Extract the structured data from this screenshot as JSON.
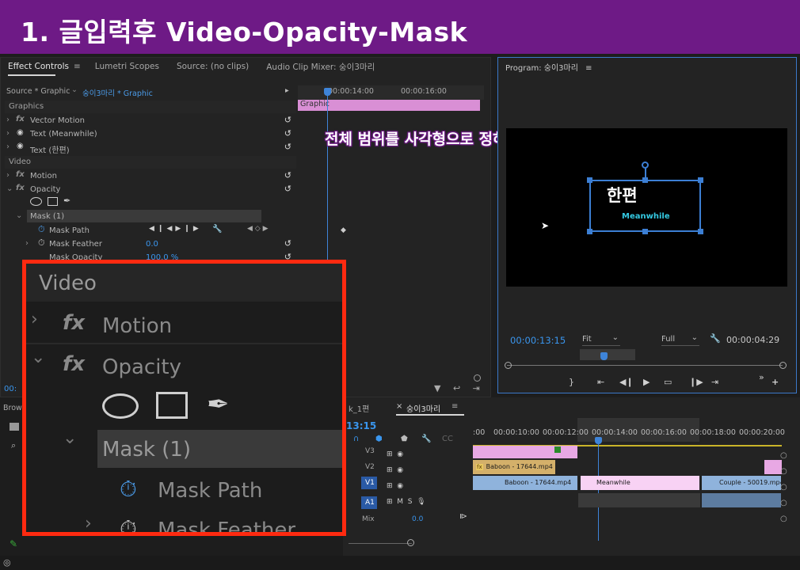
{
  "page_title": "1. 글입력후 Video-Opacity-Mask",
  "caption": "전체 범위를 사각형으로 정하고 KF생성",
  "top_tabs": {
    "effect_controls": "Effect Controls",
    "lumetri": "Lumetri Scopes",
    "source": "Source: (no clips)",
    "audio_mixer": "Audio Clip Mixer: 숭이3마리"
  },
  "source_selector": {
    "source": "Source * Graphic",
    "sequence": "숭이3마리 * Graphic"
  },
  "effect_controls": {
    "graphics_header": "Graphics",
    "vector_motion": "Vector Motion",
    "text_meanwhile": "Text (Meanwhile)",
    "text_hanpyeon": "Text (한편)",
    "video_header": "Video",
    "motion": "Motion",
    "opacity": "Opacity",
    "mask": "Mask (1)",
    "mask_path": "Mask Path",
    "mask_feather": "Mask Feather",
    "mask_feather_value": "0.0",
    "mask_opacity": "Mask Opacity",
    "mask_opacity_value": "100.0 %",
    "fx_symbol": "fx"
  },
  "ec_timeline": {
    "tc1": "00:00:14:00",
    "tc2": "00:00:16:00",
    "graphic_clip": "Graphic",
    "current_tc": "00:"
  },
  "program": {
    "title": "Program: 숭이3마리",
    "title_text": "한편",
    "subtitle_text": "Meanwhile",
    "timecode": "00:00:13:15",
    "fit": "Fit",
    "full": "Full",
    "duration": "00:00:04:29"
  },
  "timeline": {
    "tabs": [
      "k_1편",
      "숭이3마리"
    ],
    "playhead_tc": "13:15",
    "ruler": [
      ":00",
      "00:00:10:00",
      "00:00:12:00",
      "00:00:14:00",
      "00:00:16:00",
      "00:00:18:00",
      "00:00:20:00"
    ],
    "tracks": [
      "V3",
      "V2",
      "V1",
      "A1"
    ],
    "mix_label": "Mix",
    "mix_value": "0.0",
    "clips": {
      "v2_baboon": "Baboon - 17644.mp4",
      "v1_baboon": "Baboon - 17644.mp4",
      "v1_meanwhile": "Meanwhile",
      "v1_couple": "Couple - 50019.mp4 ["
    }
  },
  "browser_tab": "Brows",
  "zoom": {
    "video_header": "Video",
    "motion": "Motion",
    "opacity": "Opacity",
    "mask": "Mask (1)",
    "mask_path": "Mask Path",
    "mask_feather": "Mask Feather",
    "fx_symbol": "fx"
  },
  "colors": {
    "title_bar": "#6e1a86",
    "accent_blue": "#3a96ee",
    "highlight_red": "#ff2a10",
    "graphic_clip": "#d98fd5",
    "meanwhile_text": "#34c9e2"
  }
}
